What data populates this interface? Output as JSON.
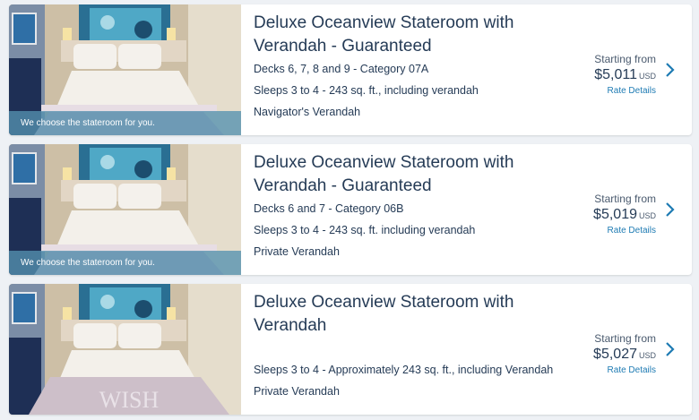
{
  "staterooms": [
    {
      "title": "Deluxe Oceanview Stateroom with Verandah - Guaranteed",
      "details": [
        "Decks 6, 7, 8 and 9 - Category 07A",
        "Sleeps 3 to 4 - 243 sq. ft., including verandah",
        "Navigator's Verandah"
      ],
      "caption": "We choose the stateroom for you.",
      "starting_label": "Starting from",
      "price": "$5,011",
      "currency": "USD",
      "rate_link": "Rate Details"
    },
    {
      "title": "Deluxe Oceanview Stateroom with Verandah - Guaranteed",
      "details": [
        "Decks 6 and 7 - Category 06B",
        "Sleeps 3 to 4 - 243 sq. ft. including verandah",
        "Private Verandah"
      ],
      "caption": "We choose the stateroom for you.",
      "starting_label": "Starting from",
      "price": "$5,019",
      "currency": "USD",
      "rate_link": "Rate Details"
    },
    {
      "title": "Deluxe Oceanview Stateroom with Verandah",
      "details": [
        "",
        "Sleeps 3 to 4 - Approximately 243 sq. ft., including Verandah",
        "Private Verandah"
      ],
      "caption": "",
      "starting_label": "Starting from",
      "price": "$5,027",
      "currency": "USD",
      "rate_link": "Rate Details",
      "bedspread_text": "WISH"
    }
  ],
  "colors": {
    "accent": "#1e7bb3",
    "text": "#253b56",
    "caption_bg": "#5491af"
  }
}
